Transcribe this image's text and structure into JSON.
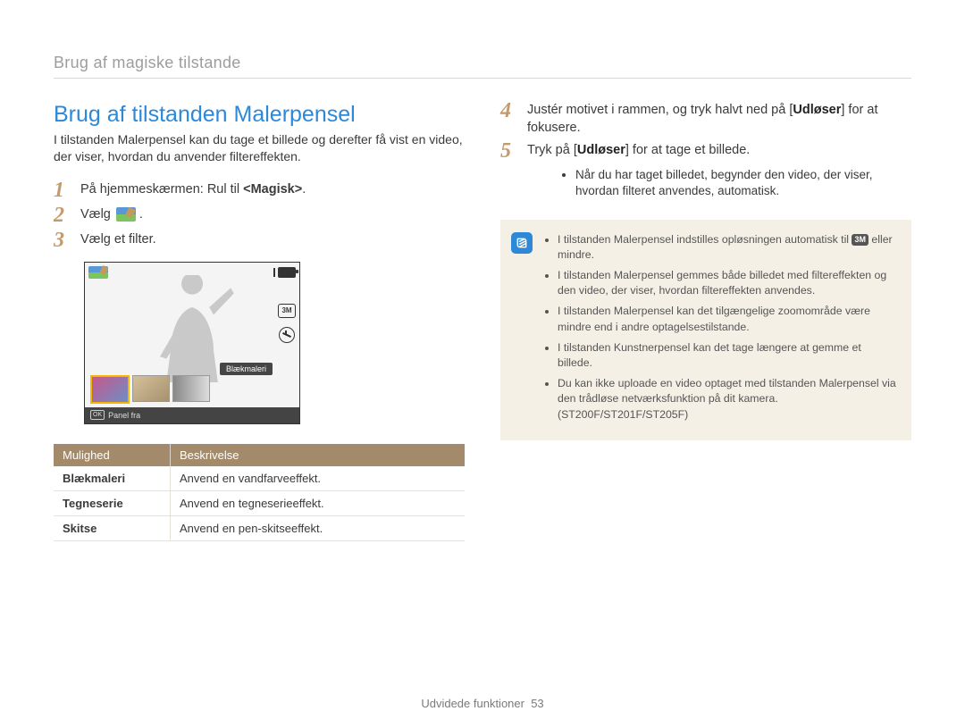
{
  "breadcrumb": "Brug af magiske tilstande",
  "title": "Brug af tilstanden Malerpensel",
  "intro": "I tilstanden Malerpensel kan du tage et billede og derefter få vist en video, der viser, hvordan du anvender filtereffekten.",
  "steps_left": {
    "s1_a": "På hjemmeskærmen: Rul til ",
    "s1_b": "<Magisk>",
    "s1_c": ".",
    "s2": "Vælg ",
    "s2_c": ".",
    "s3": "Vælg et filter."
  },
  "screen": {
    "tag": "Blækmaleri",
    "panel": "Panel fra",
    "ok": "OK",
    "size_badge": "3M"
  },
  "table": {
    "h1": "Mulighed",
    "h2": "Beskrivelse",
    "rows": [
      {
        "opt": "Blækmaleri",
        "desc": "Anvend en vandfarveeffekt."
      },
      {
        "opt": "Tegneserie",
        "desc": "Anvend en tegneserieeffekt."
      },
      {
        "opt": "Skitse",
        "desc": "Anvend en pen-skitseeffekt."
      }
    ]
  },
  "steps_right": {
    "s4_a": "Justér motivet i rammen, og tryk halvt ned på [",
    "s4_b": "Udløser",
    "s4_c": "] for at fokusere.",
    "s5_a": "Tryk på [",
    "s5_b": "Udløser",
    "s5_c": "] for at tage et billede.",
    "s5_bullet": "Når du har taget billedet, begynder den video, der viser, hvordan filteret anvendes, automatisk."
  },
  "infobox": {
    "badge_alt": "info-icon",
    "mini_badge": "3M",
    "n1_a": "I tilstanden Malerpensel indstilles opløsningen automatisk til ",
    "n1_b": " eller mindre.",
    "n2": "I tilstanden Malerpensel gemmes både billedet med filtereffekten og den video, der viser, hvordan filtereffekten anvendes.",
    "n3": "I tilstanden Malerpensel kan det tilgængelige zoomområde være mindre end i andre optagelsestilstande.",
    "n4": "I tilstanden Kunstnerpensel kan det tage længere at gemme et billede.",
    "n5": "Du kan ikke uploade en video optaget med tilstanden Malerpensel via den trådløse netværksfunktion på dit kamera. (ST200F/ST201F/ST205F)"
  },
  "footer": {
    "label": "Udvidede funktioner",
    "page": "53"
  }
}
